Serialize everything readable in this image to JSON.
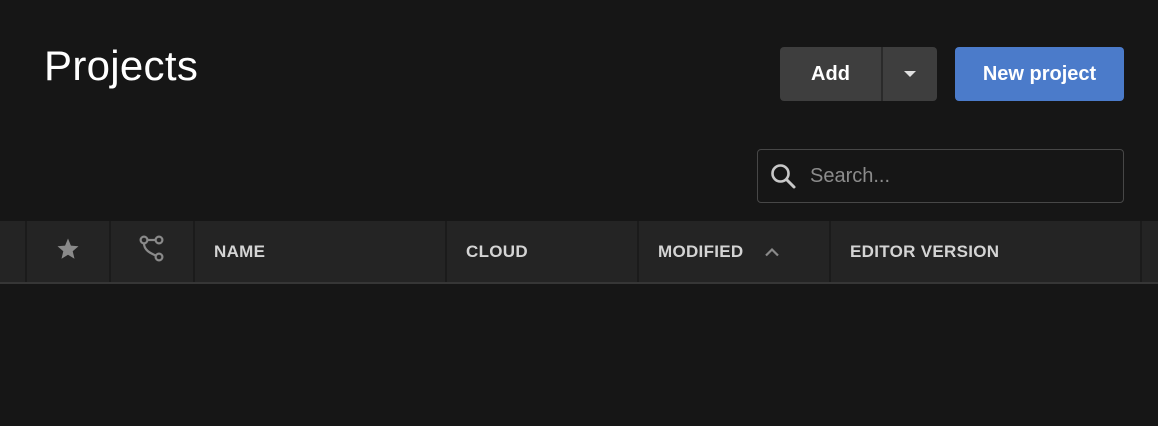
{
  "header": {
    "title": "Projects",
    "add_label": "Add",
    "new_project_label": "New project"
  },
  "search": {
    "placeholder": "Search...",
    "value": ""
  },
  "table": {
    "columns": [
      {
        "id": "favorite",
        "icon": "star-icon",
        "label": ""
      },
      {
        "id": "version-control",
        "icon": "branch-icon",
        "label": ""
      },
      {
        "id": "name",
        "label": "NAME"
      },
      {
        "id": "cloud",
        "label": "CLOUD"
      },
      {
        "id": "modified",
        "label": "MODIFIED",
        "sort": "ascending"
      },
      {
        "id": "editor-version",
        "label": "EDITOR VERSION"
      }
    ],
    "rows": []
  },
  "colors": {
    "background": "#161616",
    "header_row": "#242424",
    "add_button": "#3e3e3e",
    "primary_button": "#4b7bca",
    "header_text": "#d4d4d4"
  }
}
